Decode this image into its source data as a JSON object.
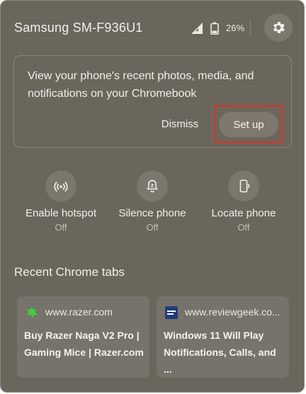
{
  "header": {
    "device_name": "Samsung SM-F936U1",
    "battery_percent": "26%",
    "icons": {
      "signal": "signal-icon",
      "battery": "battery-icon",
      "settings": "gear-icon"
    }
  },
  "promo": {
    "text": "View your phone's recent photos, media, and notifications on your Chromebook",
    "dismiss_label": "Dismiss",
    "setup_label": "Set up",
    "highlight_color": "#e0302a"
  },
  "features": [
    {
      "label": "Enable hotspot",
      "state": "Off",
      "icon": "hotspot-icon"
    },
    {
      "label": "Silence phone",
      "state": "Off",
      "icon": "silence-bell-icon"
    },
    {
      "label": "Locate phone",
      "state": "Off",
      "icon": "locate-phone-icon"
    }
  ],
  "recent_tabs": {
    "title": "Recent Chrome tabs",
    "items": [
      {
        "domain": "www.razer.com",
        "title": "Buy Razer Naga V2 Pro | Gaming Mice | Razer.com",
        "favicon": "razer-favicon"
      },
      {
        "domain": "www.reviewgeek.co...",
        "title": "Windows 11 Will Play Notifications, Calls, and ...",
        "favicon": "reviewgeek-favicon"
      }
    ]
  },
  "colors": {
    "panel_bg": "#6b665c",
    "button_bg": "#7e786e",
    "text": "#f1efe9"
  }
}
